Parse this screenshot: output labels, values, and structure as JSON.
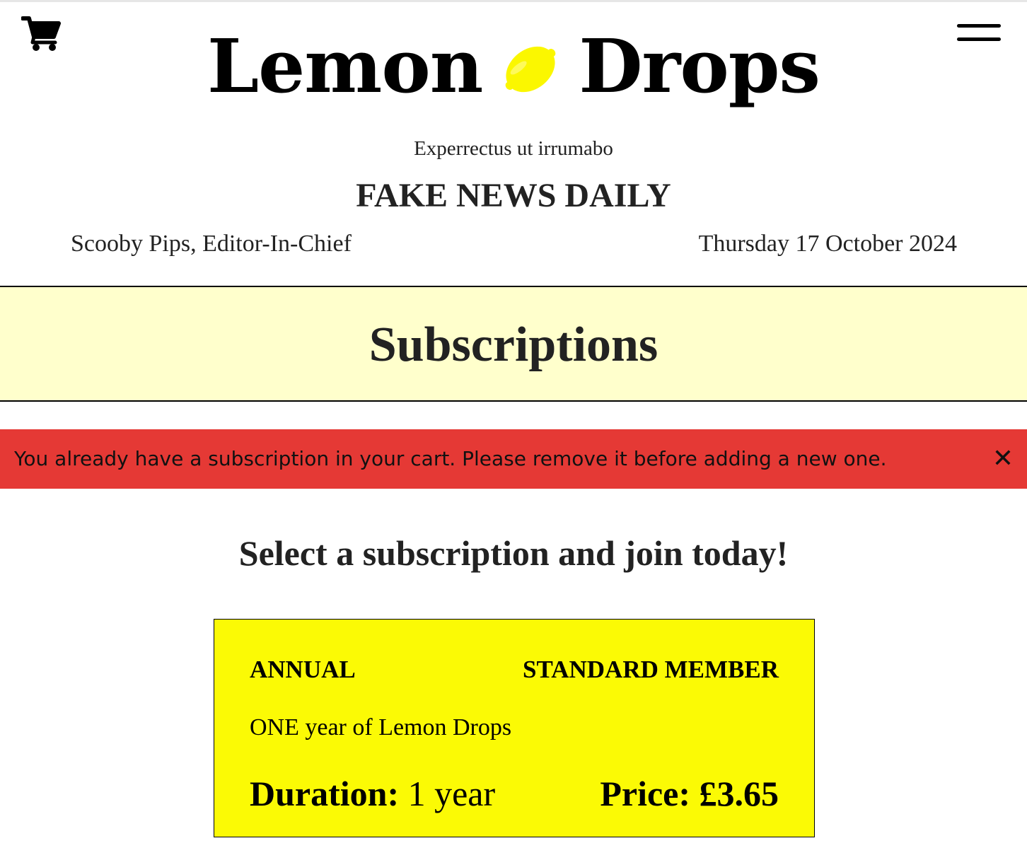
{
  "header": {
    "brand_left": "Lemon",
    "brand_right": "Drops",
    "tagline": "Experrectus ut irrumabo",
    "paper_name": "FAKE NEWS DAILY",
    "editor": "Scooby Pips, Editor-In-Chief",
    "date": "Thursday 17 October 2024",
    "icons": {
      "cart": "cart-icon",
      "menu": "hamburger-menu-icon",
      "logo": "lemon-icon"
    },
    "colors": {
      "lemon": "#fbf700"
    }
  },
  "banner": {
    "title": "Subscriptions",
    "background": "#ffffcc"
  },
  "alert": {
    "message": "You already have a subscription in your cart. Please remove it before adding a new one.",
    "close_label": "✕",
    "background": "#e53935"
  },
  "main": {
    "cta": "Select a subscription and join today!",
    "subscriptions": [
      {
        "term": "ANNUAL",
        "tier": "STANDARD MEMBER",
        "description": "ONE year of Lemon Drops",
        "duration_label": "Duration:",
        "duration_value": "1 year",
        "price_label": "Price:",
        "price_value": "£3.65",
        "background": "#fbfa05"
      }
    ]
  }
}
